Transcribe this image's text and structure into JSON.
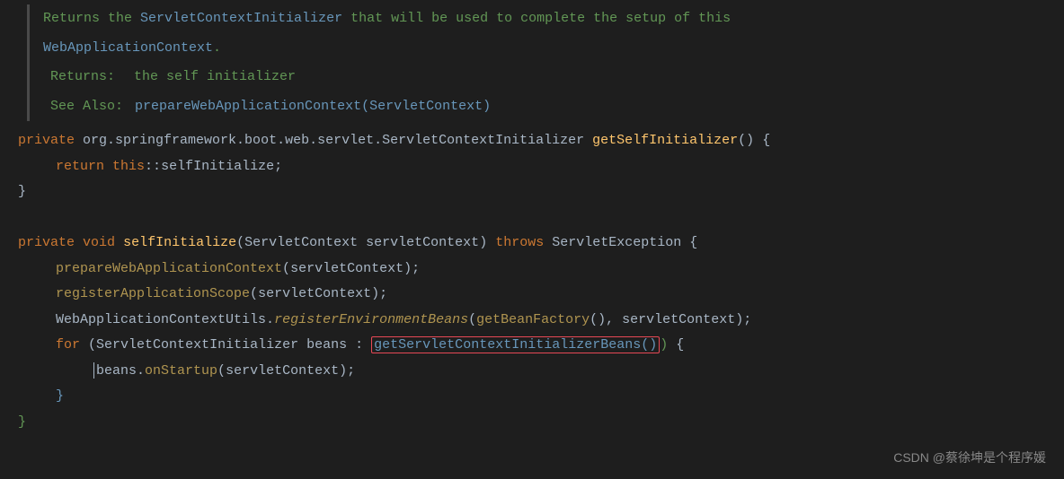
{
  "doc": {
    "line1_prefix": "Returns the ",
    "line1_link": "ServletContextInitializer",
    "line1_suffix": " that will be used to complete the setup of this",
    "line2_link": "WebApplicationContext",
    "line2_suffix": ".",
    "returns_label": "Returns:",
    "returns_text": "the self initializer",
    "seealso_label": "See Also:",
    "seealso_link": "prepareWebApplicationContext(ServletContext)"
  },
  "code": {
    "private": "private",
    "void": "void",
    "return": "return",
    "this": "this",
    "throws": "throws",
    "for": "for",
    "type_full": "org.springframework.boot.web.servlet.ServletContextInitializer",
    "getSelfInitializer": "getSelfInitializer",
    "selfInitialize_ref": "selfInitialize",
    "selfInitialize": "selfInitialize",
    "ServletContext": "ServletContext",
    "servletContext": "servletContext",
    "ServletException": "ServletException",
    "prepareWebApplicationContext": "prepareWebApplicationContext",
    "registerApplicationScope": "registerApplicationScope",
    "WebApplicationContextUtils": "WebApplicationContextUtils",
    "registerEnvironmentBeans": "registerEnvironmentBeans",
    "getBeanFactory": "getBeanFactory",
    "ServletContextInitializer": "ServletContextInitializer",
    "beans": "beans",
    "getServletContextInitializerBeans": "getServletContextInitializerBeans",
    "onStartup": "onStartup"
  },
  "watermark": "CSDN @蔡徐坤是个程序媛"
}
